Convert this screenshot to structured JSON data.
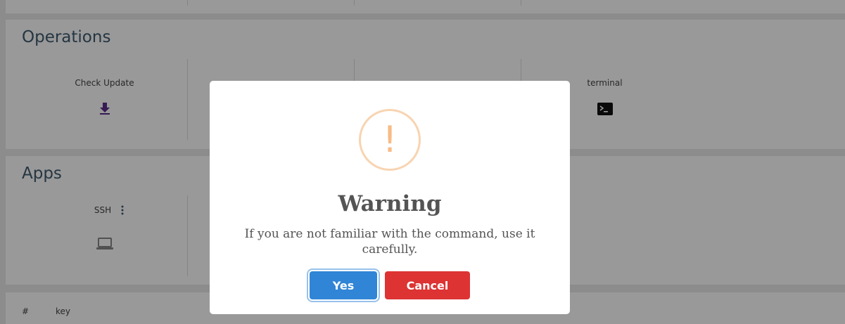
{
  "operations": {
    "title": "Operations",
    "tiles": [
      {
        "label": "Check Update",
        "icon": "download-icon"
      },
      {
        "label": "",
        "icon": ""
      },
      {
        "label": "",
        "icon": ""
      },
      {
        "label": "terminal",
        "icon": "terminal-icon"
      }
    ]
  },
  "apps": {
    "title": "Apps",
    "tiles": [
      {
        "label": "SSH",
        "icon": "laptop-icon",
        "menu_icon": "kebab-menu-icon"
      }
    ]
  },
  "table": {
    "columns": [
      "#",
      "key"
    ]
  },
  "dialog": {
    "icon": "warning-icon",
    "icon_glyph": "!",
    "title": "Warning",
    "message": "If you are not familiar with the command, use it carefully.",
    "confirm_label": "Yes",
    "cancel_label": "Cancel"
  },
  "colors": {
    "confirm": "#3085d6",
    "cancel": "#dd3333",
    "warning": "#f8bb86",
    "icon_accent": "#5b2e8c"
  }
}
